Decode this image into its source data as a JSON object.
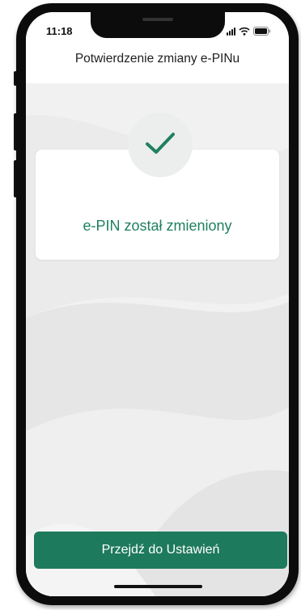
{
  "status_bar": {
    "time": "11:18",
    "icons": [
      "signal-icon",
      "wifi-icon",
      "battery-icon"
    ]
  },
  "header": {
    "title": "Potwierdzenie zmiany e-PINu"
  },
  "confirmation": {
    "icon": "checkmark-icon",
    "message": "e-PIN został zmieniony"
  },
  "actions": {
    "primary_label": "Przejdź do Ustawień"
  },
  "colors": {
    "accent": "#1e7a5c",
    "message_text": "#1f8060",
    "background": "#f1f1f1"
  }
}
